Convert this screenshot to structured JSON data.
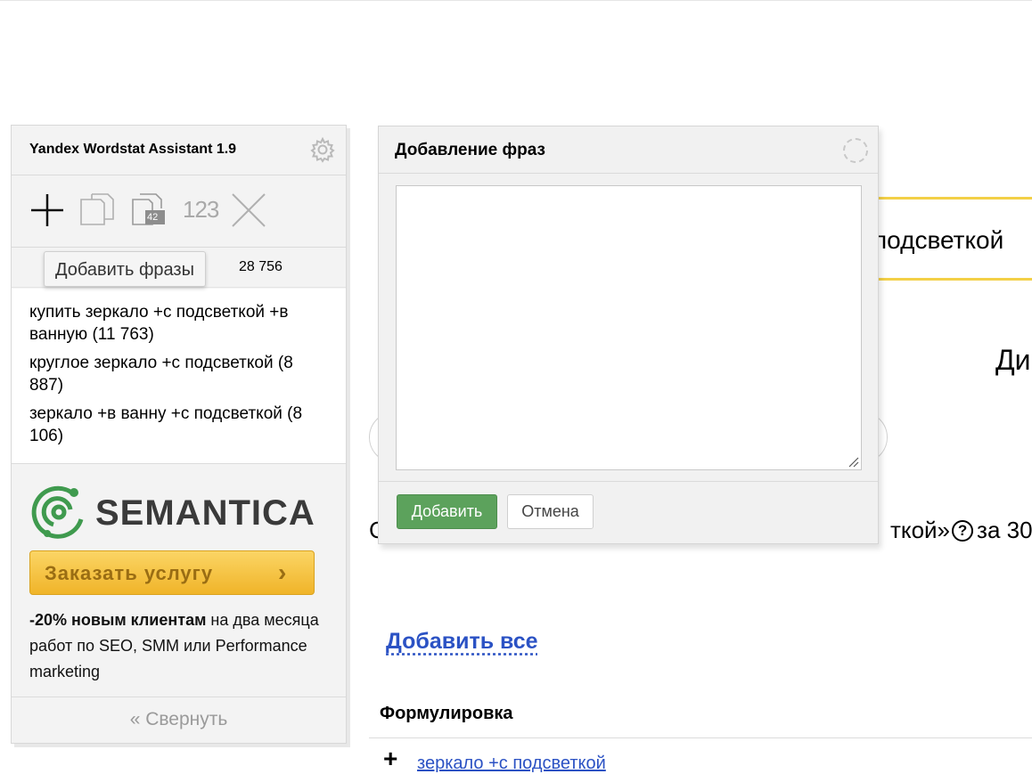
{
  "background_page": {
    "search_query_fragment": "подсветкой",
    "heading_fragment": "Ди",
    "stats_line_first": "С",
    "stats_line_tail": "ткой»",
    "stats_period": "за 30",
    "help_icon": "?",
    "add_all_link": "Добавить все",
    "column_header": "Формулировка",
    "first_row": {
      "plus": "+",
      "phrase": "зеркало +с подсветкой"
    }
  },
  "assistant": {
    "title": "Yandex Wordstat Assistant 1.9",
    "toolbar": {
      "add_icon": "plus-icon",
      "copy_icon": "copy-icon",
      "copy_with_counts_icon": "copy-with-counts-icon",
      "copy_with_counts_badge": "42",
      "sort_numbers_label": "123",
      "clear_icon": "clear-icon"
    },
    "tooltip": "Добавить фразы",
    "total_count": "28 756",
    "phrases": [
      "купить зеркало +с подсветкой +в ванную (11 763)",
      "круглое зеркало +с подсветкой (8 887)",
      "зеркало +в ванну +с подсветкой (8 106)"
    ],
    "promo": {
      "brand": "SEMANTICA",
      "button_label": "Заказать услугу",
      "button_chevron": "›",
      "text_bold": "-20% новым клиентам",
      "text_rest": "на два месяца работ по SEO, SMM или Performance marketing"
    },
    "collapse_label": "« Свернуть"
  },
  "dialog": {
    "title": "Добавление фраз",
    "textarea_value": "",
    "add_button": "Добавить",
    "cancel_button": "Отмена"
  },
  "colors": {
    "accent_yellow": "#f3d047",
    "link_blue": "#2b52c4",
    "add_green": "#5ca25c",
    "semantica_green": "#3f9a4e"
  }
}
